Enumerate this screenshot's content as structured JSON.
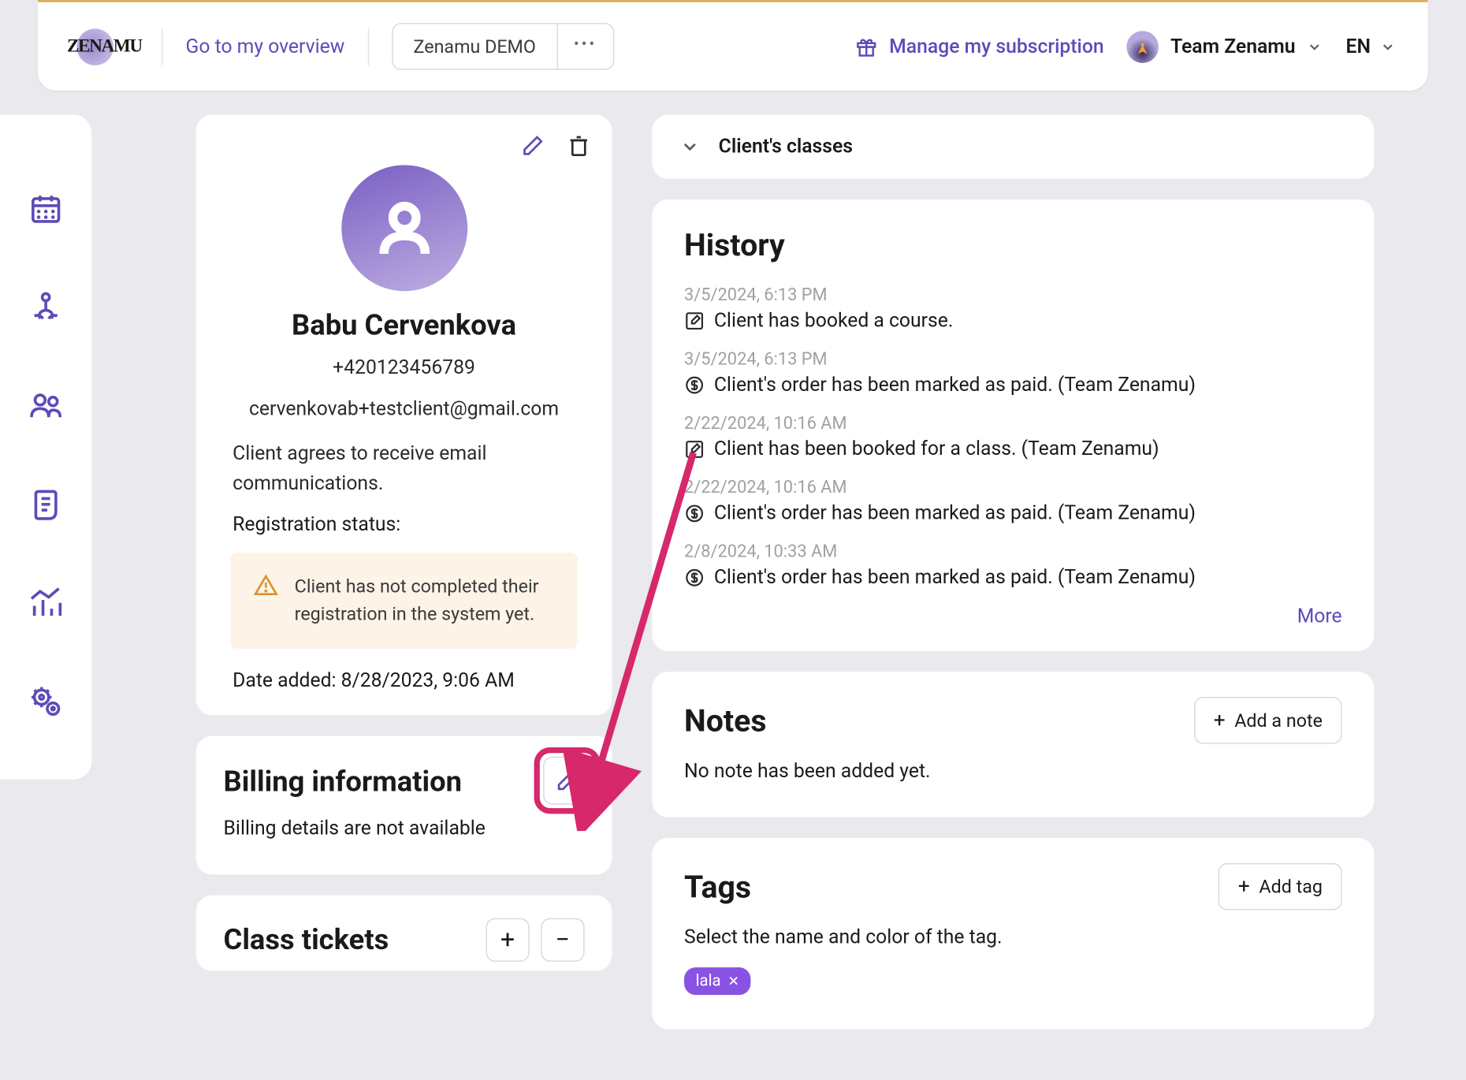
{
  "header": {
    "overview_link": "Go to my overview",
    "demo_button": "Zenamu DEMO",
    "subscription_link": "Manage my subscription",
    "team_name": "Team Zenamu",
    "language": "EN"
  },
  "profile": {
    "name": "Babu Cervenkova",
    "phone": "+420123456789",
    "email": "cervenkovab+testclient@gmail.com",
    "consent_text": "Client agrees to receive email communications.",
    "status_label": "Registration status:",
    "warning_text": "Client has not completed their registration in the system yet.",
    "date_added_label": "Date added: ",
    "date_added_value": "8/28/2023, 9:06 AM"
  },
  "billing": {
    "title": "Billing information",
    "empty_text": "Billing details are not available"
  },
  "tickets": {
    "title": "Class tickets"
  },
  "classes": {
    "title": "Client's classes"
  },
  "history": {
    "title": "History",
    "more_label": "More",
    "items": [
      {
        "time": "3/5/2024, 6:13 PM",
        "icon": "edit",
        "text": "Client has booked a course."
      },
      {
        "time": "3/5/2024, 6:13 PM",
        "icon": "dollar",
        "text": "Client's order has been marked as paid. (Team Zenamu)"
      },
      {
        "time": "2/22/2024, 10:16 AM",
        "icon": "edit",
        "text": "Client has been booked for a class. (Team Zenamu)"
      },
      {
        "time": "2/22/2024, 10:16 AM",
        "icon": "dollar",
        "text": "Client's order has been marked as paid. (Team Zenamu)"
      },
      {
        "time": "2/8/2024, 10:33 AM",
        "icon": "dollar",
        "text": "Client's order has been marked as paid. (Team Zenamu)"
      }
    ]
  },
  "notes": {
    "title": "Notes",
    "add_button": "Add a note",
    "empty_text": "No note has been added yet."
  },
  "tags": {
    "title": "Tags",
    "add_button": "Add tag",
    "hint": "Select the name and color of the tag.",
    "chips": [
      {
        "label": "lala"
      }
    ]
  }
}
